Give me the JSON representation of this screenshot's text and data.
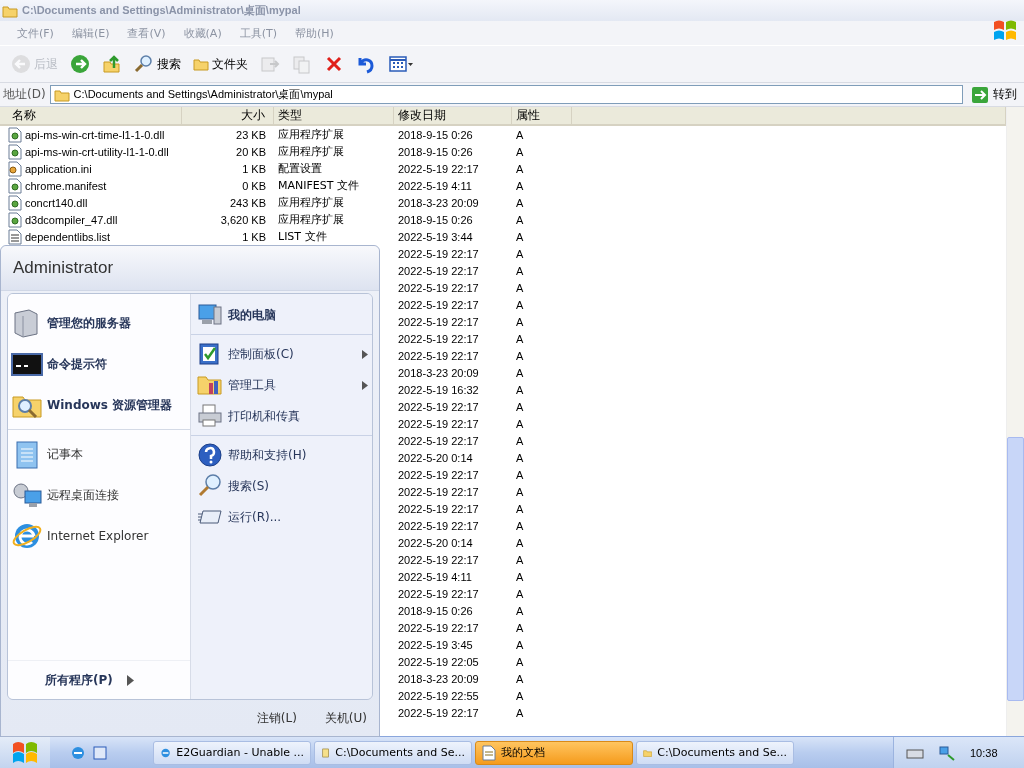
{
  "window": {
    "title": "C:\\Documents and Settings\\Administrator\\桌面\\mypal"
  },
  "menu_bar": [
    "文件(F)",
    "编辑(E)",
    "查看(V)",
    "收藏(A)",
    "工具(T)",
    "帮助(H)"
  ],
  "toolbar": [
    {
      "kind": "back",
      "label": "后退",
      "disabled": true
    },
    {
      "kind": "forward",
      "disabled": false
    },
    {
      "kind": "up",
      "disabled": false
    },
    {
      "kind": "search",
      "label": "搜索",
      "disabled": false
    },
    {
      "kind": "folders",
      "label": "文件夹",
      "disabled": false
    },
    {
      "kind": "move",
      "disabled": true
    },
    {
      "kind": "copy",
      "disabled": true
    },
    {
      "kind": "delete",
      "disabled": false
    },
    {
      "kind": "undo",
      "disabled": false
    },
    {
      "kind": "views",
      "disabled": false
    }
  ],
  "address_bar": {
    "label": "地址(D)",
    "value": "C:\\Documents and Settings\\Administrator\\桌面\\mypal",
    "go": "转到"
  },
  "table": {
    "columns": [
      "名称",
      "大小",
      "类型",
      "修改日期",
      "属性"
    ],
    "rows": [
      {
        "kind": "library",
        "name": "api-ms-win-crt-time-l1-1-0.dll",
        "size": "23 KB",
        "type": "应用程序扩展",
        "modified": "2018-9-15 0:26",
        "attributes": "A"
      },
      {
        "kind": "library",
        "name": "api-ms-win-crt-utility-l1-1-0.dll",
        "size": "20 KB",
        "type": "应用程序扩展",
        "modified": "2018-9-15 0:26",
        "attributes": "A"
      },
      {
        "kind": "settings",
        "name": "application.ini",
        "size": "1 KB",
        "type": "配置设置",
        "modified": "2022-5-19 22:17",
        "attributes": "A"
      },
      {
        "kind": "library",
        "name": "chrome.manifest",
        "size": "0 KB",
        "type": "MANIFEST 文件",
        "modified": "2022-5-19 4:11",
        "attributes": "A"
      },
      {
        "kind": "library",
        "name": "concrt140.dll",
        "size": "243 KB",
        "type": "应用程序扩展",
        "modified": "2018-3-23 20:09",
        "attributes": "A"
      },
      {
        "kind": "library",
        "name": "d3dcompiler_47.dll",
        "size": "3,620 KB",
        "type": "应用程序扩展",
        "modified": "2018-9-15 0:26",
        "attributes": "A"
      },
      {
        "kind": "text",
        "name": "dependentlibs.list",
        "size": "1 KB",
        "type": "LIST 文件",
        "modified": "2022-5-19 3:44",
        "attributes": "A"
      },
      {
        "modified": "2022-5-19 22:17",
        "attributes": "A"
      },
      {
        "modified": "2022-5-19 22:17",
        "attributes": "A"
      },
      {
        "modified": "2022-5-19 22:17",
        "attributes": "A"
      },
      {
        "modified": "2022-5-19 22:17",
        "attributes": "A"
      },
      {
        "modified": "2022-5-19 22:17",
        "attributes": "A"
      },
      {
        "modified": "2022-5-19 22:17",
        "attributes": "A"
      },
      {
        "modified": "2022-5-19 22:17",
        "attributes": "A"
      },
      {
        "modified": "2018-3-23 20:09",
        "attributes": "A"
      },
      {
        "modified": "2022-5-19 16:32",
        "attributes": "A"
      },
      {
        "modified": "2022-5-19 22:17",
        "attributes": "A"
      },
      {
        "modified": "2022-5-19 22:17",
        "attributes": "A"
      },
      {
        "modified": "2022-5-19 22:17",
        "attributes": "A"
      },
      {
        "modified": "2022-5-20 0:14",
        "attributes": "A"
      },
      {
        "modified": "2022-5-19 22:17",
        "attributes": "A"
      },
      {
        "modified": "2022-5-19 22:17",
        "attributes": "A"
      },
      {
        "modified": "2022-5-19 22:17",
        "attributes": "A"
      },
      {
        "modified": "2022-5-19 22:17",
        "attributes": "A"
      },
      {
        "modified": "2022-5-20 0:14",
        "attributes": "A"
      },
      {
        "modified": "2022-5-19 22:17",
        "attributes": "A"
      },
      {
        "modified": "2022-5-19 4:11",
        "attributes": "A"
      },
      {
        "modified": "2022-5-19 22:17",
        "attributes": "A"
      },
      {
        "modified": "2018-9-15 0:26",
        "attributes": "A"
      },
      {
        "modified": "2022-5-19 22:17",
        "attributes": "A"
      },
      {
        "modified": "2022-5-19 3:45",
        "attributes": "A"
      },
      {
        "modified": "2022-5-19 22:05",
        "attributes": "A"
      },
      {
        "modified": "2018-3-23 20:09",
        "attributes": "A"
      },
      {
        "modified": "2022-5-19 22:55",
        "attributes": "A"
      },
      {
        "modified": "2022-5-19 22:17",
        "attributes": "A"
      }
    ]
  },
  "start_menu": {
    "user": "Administrator",
    "left_items": [
      {
        "label": "管理您的服务器",
        "bold": true,
        "separated": false
      },
      {
        "label": "命令提示符",
        "bold": true,
        "separated": false
      },
      {
        "label": "Windows 资源管理器",
        "bold": true,
        "separated": false
      },
      {
        "label": "记事本",
        "bold": false,
        "separated": true
      },
      {
        "label": "远程桌面连接",
        "bold": false,
        "separated": false
      },
      {
        "label": "Internet Explorer",
        "bold": false,
        "separated": false
      }
    ],
    "all_programs": "所有程序(P)",
    "right_items": [
      {
        "label": "我的电脑",
        "bold": true,
        "submenu": false,
        "separated": false
      },
      {
        "label": "控制面板(C)",
        "bold": false,
        "submenu": true,
        "separated": true
      },
      {
        "label": "管理工具",
        "bold": false,
        "submenu": true,
        "separated": false
      },
      {
        "label": "打印机和传真",
        "bold": false,
        "submenu": false,
        "separated": false
      },
      {
        "label": "帮助和支持(H)",
        "bold": false,
        "submenu": false,
        "separated": true
      },
      {
        "label": "搜索(S)",
        "bold": false,
        "submenu": false,
        "separated": false
      },
      {
        "label": "运行(R)...",
        "bold": false,
        "submenu": false,
        "separated": false
      }
    ],
    "log_off": "注销(L)",
    "shut_down": "关机(U)"
  },
  "taskbar": {
    "tasks": [
      {
        "label": "E2Guardian - Unable ...",
        "kind": "browser",
        "selected": false
      },
      {
        "label": "C:\\Documents and Se...",
        "kind": "notepad",
        "selected": false
      },
      {
        "label": "我的文档",
        "kind": "document",
        "selected": true
      },
      {
        "label": "C:\\Documents and Se...",
        "kind": "folder",
        "selected": false
      }
    ],
    "clock": "10:38"
  }
}
